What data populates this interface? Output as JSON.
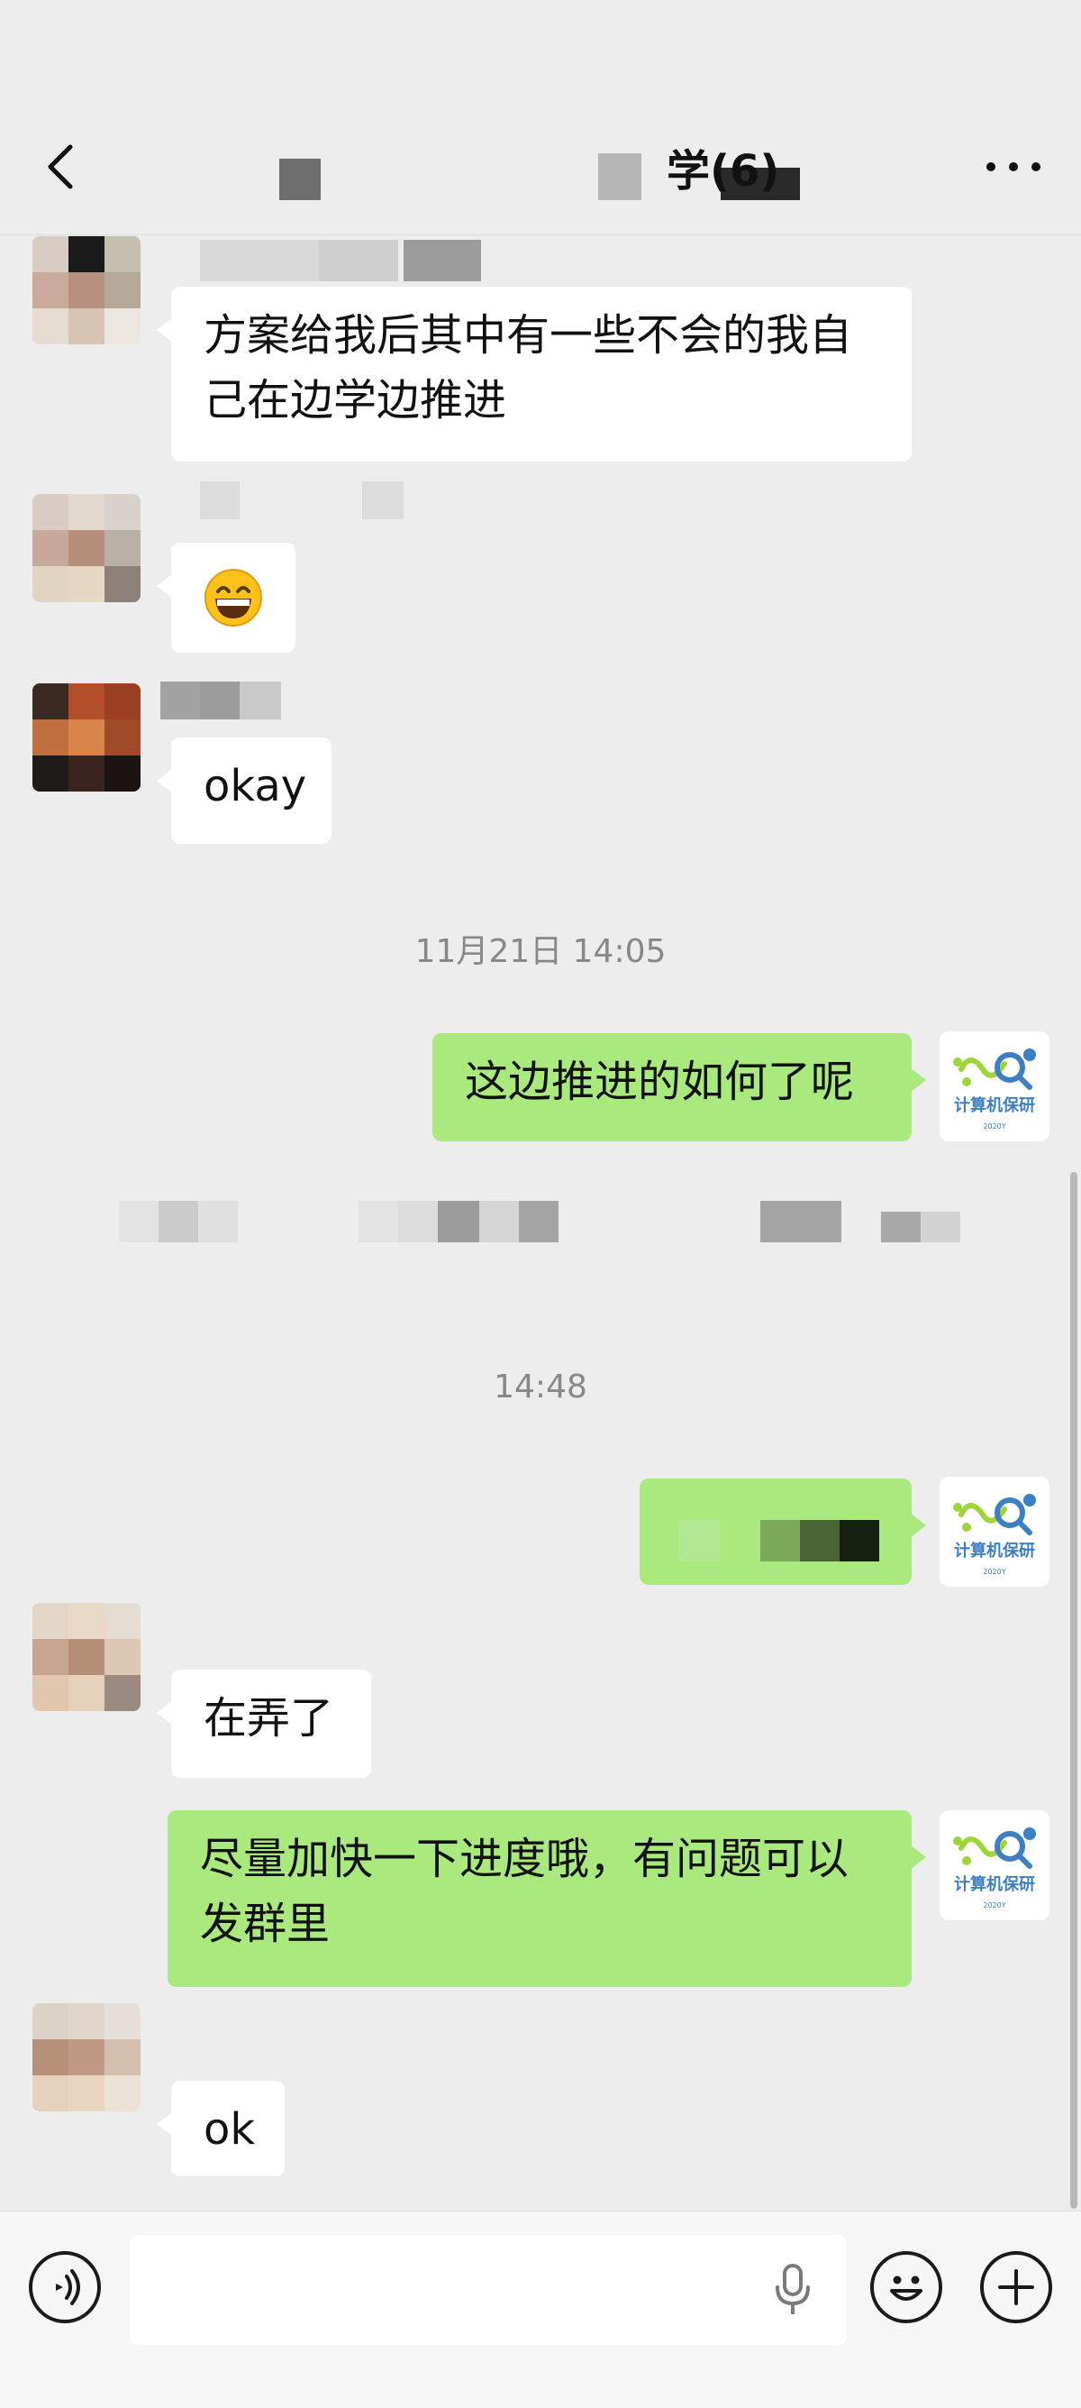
{
  "header": {
    "title": "学(6)"
  },
  "messages": [
    {
      "id": "m1",
      "direction": "in",
      "text": "方案给我后其中有一些不会的我自己在边学边推进"
    },
    {
      "id": "m2",
      "direction": "in",
      "emoji": "😁"
    },
    {
      "id": "m3",
      "direction": "in",
      "text": "okay"
    },
    {
      "id": "t1",
      "type": "timestamp",
      "text": "11月21日 14:05"
    },
    {
      "id": "m4",
      "direction": "out",
      "text": "这边推进的如何了呢"
    },
    {
      "id": "t2",
      "type": "timestamp",
      "text": "14:48"
    },
    {
      "id": "m5",
      "direction": "in",
      "text": "在弄了"
    },
    {
      "id": "m6",
      "direction": "out",
      "text": "尽量加快一下进度哦，有问题可以发群里"
    },
    {
      "id": "m7",
      "direction": "in",
      "text": "ok"
    }
  ],
  "self_avatar": {
    "label": "计算机保研",
    "sub": "2020Y"
  },
  "input_bar": {
    "placeholder": ""
  },
  "colors": {
    "background": "#ededed",
    "out_bubble": "#a9e97e",
    "in_bubble": "#ffffff",
    "brand": "#3b7fc4"
  }
}
